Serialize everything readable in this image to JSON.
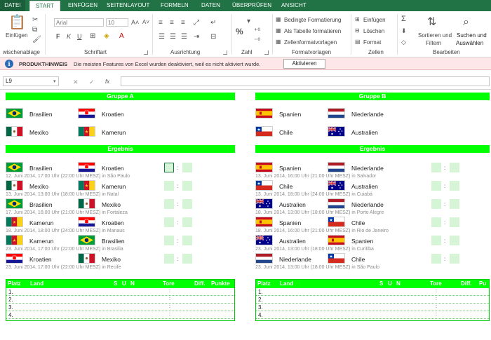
{
  "ribbon": {
    "tabs": [
      "DATEI",
      "START",
      "EINFÜGEN",
      "SEITENLAYOUT",
      "FORMELN",
      "DATEN",
      "ÜBERPRÜFEN",
      "ANSICHT"
    ],
    "paste_label": "Einfügen",
    "font_name": "Arial",
    "font_size": "10",
    "bold": "F",
    "italic": "K",
    "underline": "U",
    "number_format": "%",
    "cond_format": "Bedingte Formatierung",
    "as_table": "Als Tabelle formatieren",
    "cell_styles": "Zellenformatvorlagen",
    "insert": "Einfügen",
    "delete": "Löschen",
    "format": "Format",
    "sort_filter_1": "Sortieren und",
    "sort_filter_2": "Filtern",
    "find_1": "Suchen und",
    "find_2": "Auswählen",
    "groups": [
      "wischenablage",
      "Schriftart",
      "Ausrichtung",
      "Zahl",
      "Formatvorlagen",
      "Zellen",
      "Bearbeiten"
    ]
  },
  "message": {
    "icon": "info-icon",
    "title": "PRODUKTHINWEIS",
    "text": "Die meisten Features von Excel wurden deaktiviert, weil es nicht aktiviert wurde.",
    "button": "Aktivieren"
  },
  "formula_bar": {
    "cell_ref": "L9",
    "cancel_glyph": "✕",
    "enter_glyph": "✓",
    "fx": "fx",
    "value": ""
  },
  "groups": {
    "a": {
      "title": "Gruppe A",
      "teams": [
        {
          "name": "Brasilien",
          "flag": "brazil"
        },
        {
          "name": "Kroatien",
          "flag": "croatia"
        },
        {
          "name": "Mexiko",
          "flag": "mexico"
        },
        {
          "name": "Kamerun",
          "flag": "cameroon"
        }
      ]
    },
    "b": {
      "title": "Gruppe B",
      "teams": [
        {
          "name": "Spanien",
          "flag": "spain"
        },
        {
          "name": "Niederlande",
          "flag": "netherlands"
        },
        {
          "name": "Chile",
          "flag": "chile"
        },
        {
          "name": "Australien",
          "flag": "australia"
        }
      ]
    }
  },
  "results": {
    "title": "Ergebnis",
    "a": [
      {
        "home": "Brasilien",
        "home_flag": "brazil",
        "away": "Kroatien",
        "away_flag": "croatia",
        "info": "12. Juni 2014, 17:00 Uhr (22:00 Uhr MESZ) in São Paulo"
      },
      {
        "home": "Mexiko",
        "home_flag": "mexico",
        "away": "Kamerun",
        "away_flag": "cameroon",
        "info": "13. Juni 2014, 13:00 Uhr (18:00 Uhr MESZ) in Natal"
      },
      {
        "home": "Brasilien",
        "home_flag": "brazil",
        "away": "Mexiko",
        "away_flag": "mexico",
        "info": "17. Juni 2014, 16:00 Uhr (21:00 Uhr MESZ) in Fortaleza"
      },
      {
        "home": "Kamerun",
        "home_flag": "cameroon",
        "away": "Kroatien",
        "away_flag": "croatia",
        "info": "18. Juni 2014, 18:00 Uhr (24:00 Uhr MESZ) in Manaus"
      },
      {
        "home": "Kamerun",
        "home_flag": "cameroon",
        "away": "Brasilien",
        "away_flag": "brazil",
        "info": "23. Juni 2014, 17:00 Uhr (22:00 Uhr MESZ) in Brasilia"
      },
      {
        "home": "Kroatien",
        "home_flag": "croatia",
        "away": "Mexiko",
        "away_flag": "mexico",
        "info": "23. Juni 2014, 17:00 Uhr (22:00 Uhr MESZ) in Recife"
      }
    ],
    "b": [
      {
        "home": "Spanien",
        "home_flag": "spain",
        "away": "Niederlande",
        "away_flag": "netherlands",
        "info": "13. Juni 2014, 16:00 Uhr (21:00 Uhr MESZ) in Salvador"
      },
      {
        "home": "Chile",
        "home_flag": "chile",
        "away": "Australien",
        "away_flag": "australia",
        "info": "13. Juni 2014, 18:00 Uhr (24:00 Uhr MESZ) in Cuiabá"
      },
      {
        "home": "Australien",
        "home_flag": "australia",
        "away": "Niederlande",
        "away_flag": "netherlands",
        "info": "18. Juni 2014, 13:00 Uhr (18:00 Uhr MESZ) in Porto Alegre"
      },
      {
        "home": "Spanien",
        "home_flag": "spain",
        "away": "Chile",
        "away_flag": "chile",
        "info": "18. Juni 2014, 16:00 Uhr (21:00 Uhr MESZ) in Rio de Janeiro"
      },
      {
        "home": "Australien",
        "home_flag": "australia",
        "away": "Spanien",
        "away_flag": "spain",
        "info": "23. Juni 2014, 13:00 Uhr (18:00 Uhr MESZ) in Curitiba"
      },
      {
        "home": "Niederlande",
        "home_flag": "netherlands",
        "away": "Chile",
        "away_flag": "chile",
        "info": "23. Juni 2014, 13:00 Uhr (18:00 Uhr MESZ) in São Paulo"
      }
    ]
  },
  "standings": {
    "headers": {
      "platz": "Platz",
      "land": "Land",
      "s": "S",
      "u": "U",
      "n": "N",
      "tore": "Tore",
      "diff": "Diff.",
      "punkte": "Punkte",
      "punkte_b": "Pu"
    },
    "ranks": [
      "1.",
      "2.",
      "3.",
      "4."
    ],
    "sep": ":"
  },
  "colors": {
    "excel_green": "#217346",
    "header_green": "#00ff00",
    "score_cell": "#d6f5d6",
    "message_bg": "#fde7e9"
  }
}
